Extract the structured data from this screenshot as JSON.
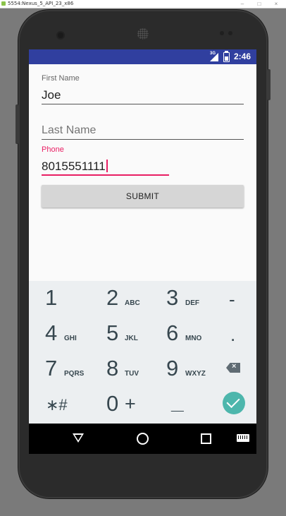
{
  "window": {
    "title": "5554:Nexus_5_API_23_x86",
    "minimize": "–",
    "maximize": "□",
    "close": "×"
  },
  "status_bar": {
    "network": "3G",
    "time": "2:46",
    "color": "#303f9f"
  },
  "form": {
    "first_name": {
      "label": "First Name",
      "value": "Joe"
    },
    "last_name": {
      "placeholder": "Last Name"
    },
    "phone": {
      "label": "Phone",
      "value": "8015551111",
      "accent": "#e91e63"
    },
    "submit_label": "SUBMIT"
  },
  "keypad": {
    "keys": [
      {
        "num": "1",
        "letters": ""
      },
      {
        "num": "2",
        "letters": "ABC"
      },
      {
        "num": "3",
        "letters": "DEF"
      },
      {
        "num": "4",
        "letters": "GHI"
      },
      {
        "num": "5",
        "letters": "JKL"
      },
      {
        "num": "6",
        "letters": "MNO"
      },
      {
        "num": "7",
        "letters": "PQRS"
      },
      {
        "num": "8",
        "letters": "TUV"
      },
      {
        "num": "9",
        "letters": "WXYZ"
      },
      {
        "num": "0",
        "letters": "+"
      }
    ],
    "symbols": {
      "minus": "-",
      "dot": ".",
      "star_hash": "∗#",
      "space": "__"
    },
    "done_color": "#4db6ac"
  },
  "icons": {
    "status": [
      "signal-icon",
      "battery-icon"
    ],
    "keypad": [
      "backspace-icon",
      "done-check-icon"
    ],
    "nav": [
      "back-icon",
      "home-icon",
      "recents-icon",
      "keyboard-icon"
    ]
  }
}
